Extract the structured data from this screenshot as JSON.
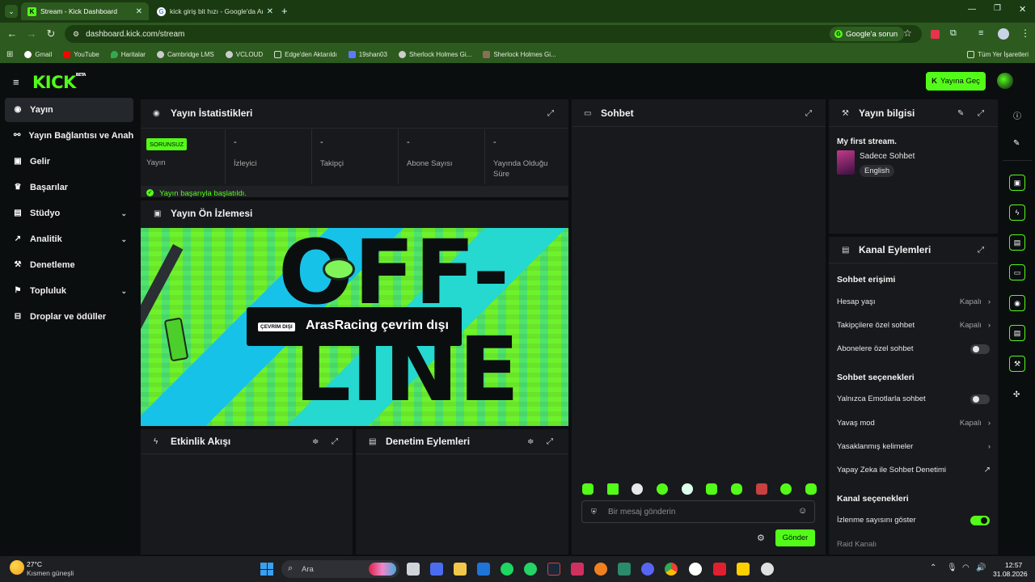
{
  "browser": {
    "tabs": [
      {
        "title": "Stream - Kick Dashboard"
      },
      {
        "title": "kick giriş bit hızı - Google'da Ar"
      }
    ],
    "url": "dashboard.kick.com/stream",
    "google_btn": "Google'a sorun",
    "bookmarks": [
      "Gmail",
      "YouTube",
      "Haritalar",
      "Cambridge LMS",
      "VCLOUD",
      "Edge'den Aktarıldı",
      "19shan03",
      "Sherlock Holmes Gi...",
      "Sherlock Holmes Gi..."
    ],
    "all_bookmarks": "Tüm Yer İşaretleri"
  },
  "header": {
    "logo": "KICK",
    "beta": "BETA",
    "go_live": "Yayına Geç"
  },
  "sidebar": {
    "items": [
      {
        "label": "Yayın",
        "icon": "broadcast-icon"
      },
      {
        "label": "Yayın Bağlantısı ve Anahtarı",
        "icon": "link-icon"
      },
      {
        "label": "Gelir",
        "icon": "wallet-icon"
      },
      {
        "label": "Başarılar",
        "icon": "trophy-icon"
      },
      {
        "label": "Stüdyo",
        "icon": "studio-icon"
      },
      {
        "label": "Analitik",
        "icon": "chart-icon"
      },
      {
        "label": "Denetleme",
        "icon": "wrench-icon"
      },
      {
        "label": "Topluluk",
        "icon": "community-icon"
      },
      {
        "label": "Droplar ve ödüller",
        "icon": "gift-icon"
      }
    ]
  },
  "stats": {
    "title": "Yayın İstatistikleri",
    "badge": "SORUNSUZ",
    "cells": [
      {
        "value": "",
        "label": "Yayın"
      },
      {
        "value": "-",
        "label": "İzleyici"
      },
      {
        "value": "-",
        "label": "Takipçi"
      },
      {
        "value": "-",
        "label": "Abone Sayısı"
      },
      {
        "value": "-",
        "label": "Yayında Olduğu Süre"
      }
    ],
    "success": "Yayın başarıyla başlatıldı."
  },
  "preview": {
    "title": "Yayın Ön İzlemesi",
    "offline_badge": "ÇEVRİM DIŞI",
    "offline_text": "ArasRacing çevrim dışı",
    "bg_text_1": "OFF-",
    "bg_text_2": "LINE"
  },
  "activity": {
    "title": "Etkinlik Akışı"
  },
  "moderation": {
    "title": "Denetim Eylemleri"
  },
  "chat": {
    "title": "Sohbet",
    "placeholder": "Bir mesaj gönderin",
    "send": "Gönder"
  },
  "stream_info": {
    "title": "Yayın bilgisi",
    "stream_title": "My first stream.",
    "category": "Sadece Sohbet",
    "language": "English"
  },
  "channel_actions": {
    "title": "Kanal Eylemleri",
    "chat_access": "Sohbet erişimi",
    "account_age": {
      "label": "Hesap yaşı",
      "value": "Kapalı"
    },
    "followers_only": {
      "label": "Takipçilere özel sohbet",
      "value": "Kapalı"
    },
    "subscribers_only": {
      "label": "Abonelere özel sohbet"
    },
    "chat_options": "Sohbet seçenekleri",
    "emotes_only": {
      "label": "Yalnızca Emotlarla sohbet"
    },
    "slow_mode": {
      "label": "Yavaş mod",
      "value": "Kapalı"
    },
    "banned_words": {
      "label": "Yasaklanmış kelimeler"
    },
    "ai_moderation": {
      "label": "Yapay Zeka ile Sohbet Denetimi"
    },
    "channel_options": "Kanal seçenekleri",
    "show_viewers": {
      "label": "İzlenme sayısını göster"
    },
    "raid": {
      "label": "Raid Kanalı"
    }
  },
  "taskbar": {
    "temp": "27°C",
    "weather": "Kısmen güneşli",
    "search": "Ara",
    "time": "12:57",
    "date": "31.08.2026"
  },
  "colors": {
    "accent": "#53fc18",
    "panel": "#18191c",
    "bg": "#0b0e0f"
  }
}
